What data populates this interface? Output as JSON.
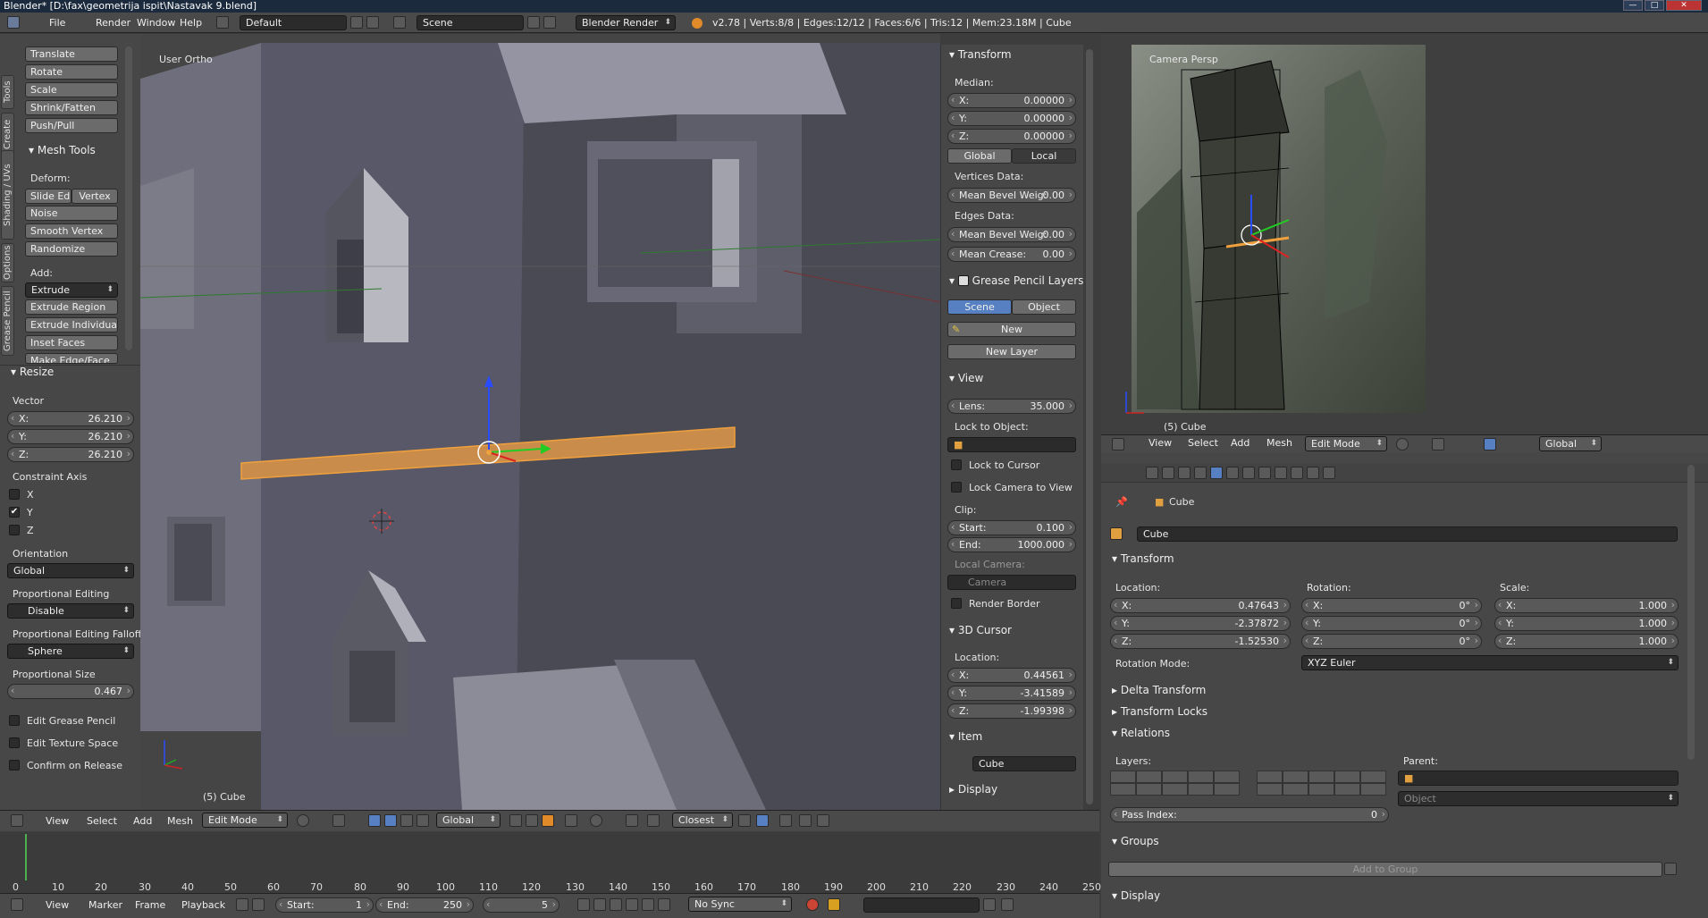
{
  "window": {
    "title": "Blender* [D:\\fax\\geometrija ispit\\Nastavak 9.blend]",
    "min": "—",
    "max": "□",
    "close": "✕"
  },
  "topbar": {
    "menus": [
      "File",
      "Render",
      "Window",
      "Help"
    ],
    "layout": "Default",
    "scene": "Scene",
    "engine": "Blender Render",
    "stats": "v2.78 | Verts:8/8 | Edges:12/12 | Faces:6/6 | Tris:12 | Mem:23.18M | Cube"
  },
  "tool_tabs": [
    "Tools",
    "Create",
    "Shading / UVs",
    "Options",
    "Grease Pencil"
  ],
  "tools": {
    "transform_buttons": [
      "Translate",
      "Rotate",
      "Scale",
      "Shrink/Fatten",
      "Push/Pull"
    ],
    "mesh_tools_header": "Mesh Tools",
    "deform_label": "Deform:",
    "slide_edge": "Slide Ed",
    "vertex": "Vertex",
    "deform_buttons": [
      "Noise",
      "Smooth Vertex",
      "Randomize"
    ],
    "add_label": "Add:",
    "extrude": "Extrude",
    "add_buttons": [
      "Extrude Region",
      "Extrude Individual",
      "Inset Faces",
      "Make Edge/Face"
    ]
  },
  "operator": {
    "header": "Resize",
    "vector_label": "Vector",
    "vector": [
      {
        "axis": "X:",
        "value": "26.210"
      },
      {
        "axis": "Y:",
        "value": "26.210"
      },
      {
        "axis": "Z:",
        "value": "26.210"
      }
    ],
    "constraint_label": "Constraint Axis",
    "constraints": [
      {
        "axis": "X",
        "checked": false
      },
      {
        "axis": "Y",
        "checked": true
      },
      {
        "axis": "Z",
        "checked": false
      }
    ],
    "orientation_label": "Orientation",
    "orientation": "Global",
    "prop_edit_label": "Proportional Editing",
    "prop_edit": "Disable",
    "falloff_label": "Proportional Editing Falloff",
    "falloff": "Sphere",
    "prop_size_label": "Proportional Size",
    "prop_size": "0.467",
    "options": [
      "Edit Grease Pencil",
      "Edit Texture Space",
      "Confirm on Release"
    ]
  },
  "viewport": {
    "view_name": "User Ortho",
    "object_label": "(5) Cube",
    "menus": [
      "View",
      "Select",
      "Add",
      "Mesh"
    ],
    "mode": "Edit Mode",
    "orientation": "Global",
    "snap": "Closest"
  },
  "properties_n": {
    "transform_header": "Transform",
    "median_label": "Median:",
    "median": [
      {
        "axis": "X:",
        "value": "0.00000"
      },
      {
        "axis": "Y:",
        "value": "0.00000"
      },
      {
        "axis": "Z:",
        "value": "0.00000"
      }
    ],
    "global": "Global",
    "local": "Local",
    "vertices_data": "Vertices Data:",
    "mean_bevel_v": {
      "label": "Mean Bevel Weig:",
      "value": "0.00"
    },
    "edges_data": "Edges Data:",
    "mean_bevel_e": {
      "label": "Mean Bevel Weig:",
      "value": "0.00"
    },
    "mean_crease": {
      "label": "Mean Crease:",
      "value": "0.00"
    },
    "gp_header": "Grease Pencil Layers",
    "scene_btn": "Scene",
    "object_btn": "Object",
    "new_btn": "New",
    "new_layer_btn": "New Layer",
    "view_header": "View",
    "lens": {
      "label": "Lens:",
      "value": "35.000"
    },
    "lock_obj_label": "Lock to Object:",
    "lock_cursor": "Lock to Cursor",
    "lock_camera": "Lock Camera to View",
    "clip_label": "Clip:",
    "clip_start": {
      "label": "Start:",
      "value": "0.100"
    },
    "clip_end": {
      "label": "End:",
      "value": "1000.000"
    },
    "local_camera_label": "Local Camera:",
    "camera_field": "Camera",
    "render_border": "Render Border",
    "cursor_header": "3D Cursor",
    "location_label": "Location:",
    "cursor": [
      {
        "axis": "X:",
        "value": "0.44561"
      },
      {
        "axis": "Y:",
        "value": "-3.41589"
      },
      {
        "axis": "Z:",
        "value": "-1.99398"
      }
    ],
    "item_header": "Item",
    "item_name": "Cube",
    "display_header": "Display"
  },
  "camera_view": {
    "label": "Camera Persp",
    "object_label": "(5) Cube"
  },
  "camera_header": {
    "menus": [
      "View",
      "Select",
      "Add",
      "Mesh"
    ],
    "mode": "Edit Mode",
    "orientation": "Global"
  },
  "object_props": {
    "breadcrumb": "Cube",
    "name": "Cube",
    "transform_header": "Transform",
    "location_label": "Location:",
    "rotation_label": "Rotation:",
    "scale_label": "Scale:",
    "location": [
      {
        "axis": "X:",
        "value": "0.47643"
      },
      {
        "axis": "Y:",
        "value": "-2.37872"
      },
      {
        "axis": "Z:",
        "value": "-1.52530"
      }
    ],
    "rotation": [
      {
        "axis": "X:",
        "value": "0°"
      },
      {
        "axis": "Y:",
        "value": "0°"
      },
      {
        "axis": "Z:",
        "value": "0°"
      }
    ],
    "scale": [
      {
        "axis": "X:",
        "value": "1.000"
      },
      {
        "axis": "Y:",
        "value": "1.000"
      },
      {
        "axis": "Z:",
        "value": "1.000"
      }
    ],
    "rotation_mode_label": "Rotation Mode:",
    "rotation_mode": "XYZ Euler",
    "collapsed": [
      "Delta Transform",
      "Transform Locks"
    ],
    "relations_header": "Relations",
    "layers_label": "Layers:",
    "parent_label": "Parent:",
    "parent_type": "Object",
    "pass_index": {
      "label": "Pass Index:",
      "value": "0"
    },
    "groups_header": "Groups",
    "add_to_group": "Add to Group",
    "display_header": "Display"
  },
  "timeline": {
    "ticks": [
      "0",
      "10",
      "20",
      "30",
      "40",
      "50",
      "60",
      "70",
      "80",
      "90",
      "100",
      "110",
      "120",
      "130",
      "140",
      "150",
      "160",
      "170",
      "180",
      "190",
      "200",
      "210",
      "220",
      "230",
      "240",
      "250"
    ],
    "current_frame_marker": 5,
    "menus": [
      "View",
      "Marker",
      "Frame",
      "Playback"
    ],
    "start": {
      "label": "Start:",
      "value": "1"
    },
    "end": {
      "label": "End:",
      "value": "250"
    },
    "current": "5",
    "sync": "No Sync"
  },
  "colors": {
    "selection": "#e8a24a",
    "accent_blue": "#5680c2",
    "bg": "#3d3d3d"
  }
}
